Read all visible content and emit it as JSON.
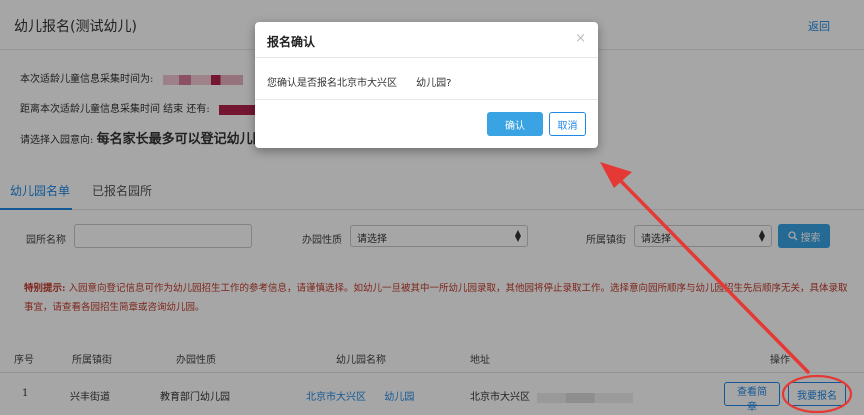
{
  "header": {
    "title": "幼儿报名(测试幼儿)",
    "back_label": "返回"
  },
  "info": {
    "collect_time_label": "本次适龄儿童信息采集时间为:",
    "countdown_label": "距离本次适龄儿童信息采集时间 结束 还有:",
    "intent_label": "请选择入园意向:",
    "intent_text": "每名家长最多可以登记幼儿园共"
  },
  "tabs": [
    {
      "label": "幼儿园名单",
      "active": true
    },
    {
      "label": "已报名园所",
      "active": false
    }
  ],
  "filters": {
    "name_label": "园所名称",
    "name_value": "",
    "type_label": "办园性质",
    "type_selected": "请选择",
    "town_label": "所属镇街",
    "town_selected": "请选择",
    "search_label": "搜索"
  },
  "notice": {
    "label": "特别提示:",
    "text": "入园意向登记信息可作为幼儿园招生工作的参考信息，请谨慎选择。如幼儿一旦被其中一所幼儿园录取，其他园将停止录取工作。选择意向园所顺序与幼儿园招生先后顺序无关，具体录取事宜，请查看各园招生简章或咨询幼儿园。"
  },
  "table": {
    "headers": [
      "序号",
      "所属镇街",
      "办园性质",
      "幼儿园名称",
      "地址",
      "操作"
    ],
    "rows": [
      {
        "index": "1",
        "town": "兴丰街道",
        "type": "教育部门幼儿园",
        "name_prefix": "北京市大兴区",
        "name_suffix": "幼儿园",
        "address": "北京市大兴区",
        "view_label": "查看简章",
        "apply_label": "我要报名"
      }
    ]
  },
  "modal": {
    "title": "报名确认",
    "close_icon": "×",
    "message": "您确认是否报名北京市大兴区      幼儿园?",
    "confirm_label": "确认",
    "cancel_label": "取消"
  },
  "colors": {
    "accent": "#1e88e5",
    "primary_button": "#3aa3e3",
    "notice": "#c0392b",
    "annotation": "#e53935"
  }
}
